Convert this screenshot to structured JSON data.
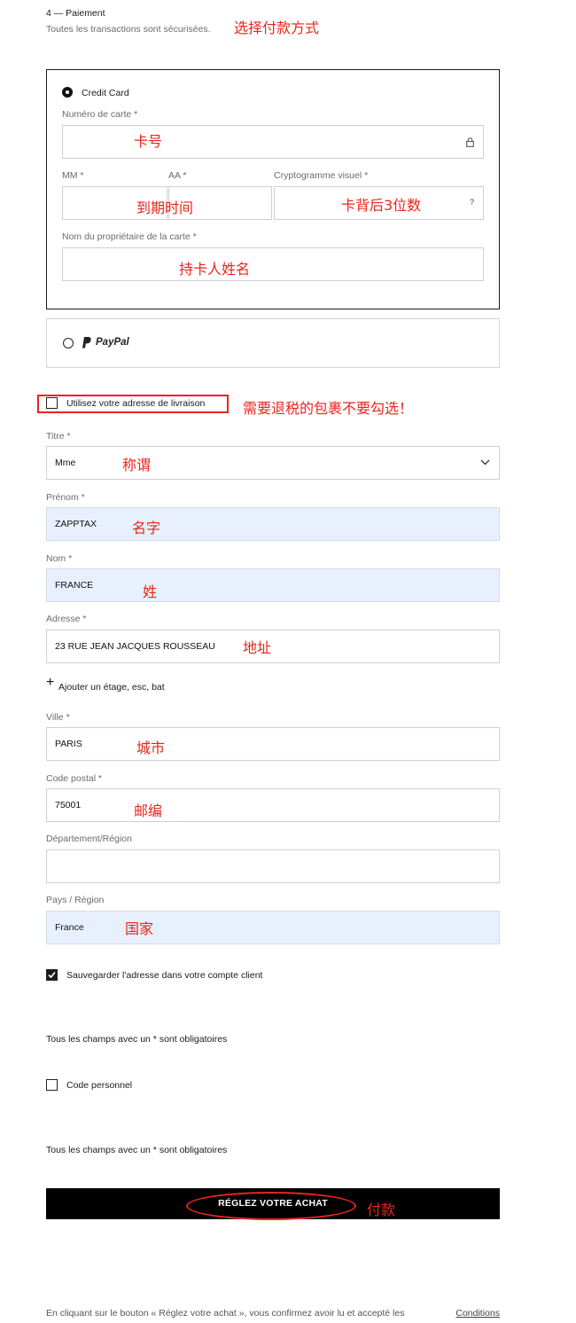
{
  "header": {
    "step": "4 — Paiement",
    "subtitle": "Toutes les transactions sont sécurisées."
  },
  "payment": {
    "credit_card_label": "Credit Card",
    "card_number_label": "Numéro de carte *",
    "mm_label": "MM *",
    "aa_label": "AA *",
    "cvv_label": "Cryptogramme visuel *",
    "cvv_help": "?",
    "holder_label": "Nom du propriétaire de la carte *",
    "paypal_label": "PayPal"
  },
  "use_shipping_address_label": "Utilisez votre adresse de livraison",
  "form": {
    "title_label": "Titre *",
    "title_value": "Mme",
    "firstname_label": "Prénom *",
    "firstname_value": "ZAPPTAX",
    "lastname_label": "Nom *",
    "lastname_value": "FRANCE",
    "address_label": "Adresse *",
    "address_value": "23 RUE JEAN JACQUES ROUSSEAU",
    "add_floor_label": "Ajouter un étage, esc, bat",
    "city_label": "Ville *",
    "city_value": "PARIS",
    "postal_label": "Code postal *",
    "postal_value": "75001",
    "region_label": "Département/Région",
    "region_value": "",
    "country_label": "Pays / Région",
    "country_value": "France"
  },
  "save_address_label": "Sauvegarder l'adresse dans votre compte client",
  "required_note": "Tous les champs avec un * sont obligatoires",
  "personal_code_label": "Code personnel",
  "required_note_2": "Tous les champs avec un * sont obligatoires",
  "submit_label": "RÉGLEZ VOTRE ACHAT",
  "footer": {
    "text": "En cliquant sur le bouton « Réglez votre achat », vous confirmez avoir lu et accepté les",
    "link": "Conditions"
  },
  "annotations": {
    "payment_method": "选择付款方式",
    "card_number": "卡号",
    "expiry": "到期时间",
    "cvv": "卡背后3位数",
    "holder": "持卡人姓名",
    "no_check": "需要退税的包裹不要勾选！",
    "title": "称谓",
    "firstname": "名字",
    "lastname": "姓",
    "address": "地址",
    "city": "城市",
    "postal": "邮编",
    "country": "国家",
    "pay": "付款"
  },
  "colors": {
    "annotation": "#e8261c",
    "autofill": "#e8f0fe",
    "button": "#000000"
  }
}
